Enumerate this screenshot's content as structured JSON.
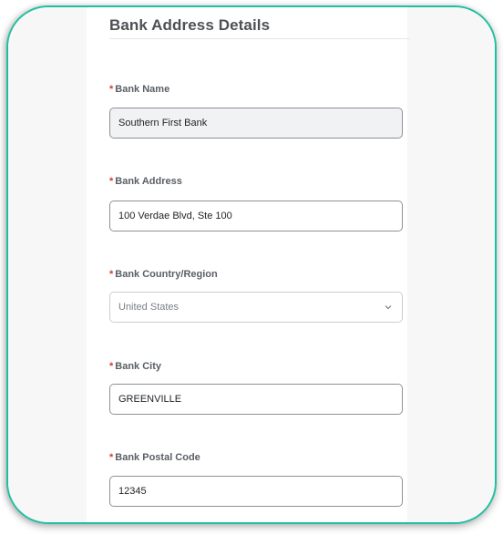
{
  "section": {
    "title": "Bank Address Details"
  },
  "required_marker": "*",
  "fields": {
    "bank_name": {
      "label": "Bank Name",
      "value": "Southern First Bank"
    },
    "bank_address": {
      "label": "Bank Address",
      "value": "100 Verdae Blvd, Ste 100"
    },
    "bank_country": {
      "label": "Bank Country/Region",
      "value": "United States"
    },
    "bank_city": {
      "label": "Bank City",
      "value": "GREENVILLE"
    },
    "bank_postal_code": {
      "label": "Bank Postal Code",
      "value": "12345"
    }
  },
  "icons": {
    "dropdown": "chevron-down-icon"
  },
  "colors": {
    "card_border": "#1fbfa3",
    "required": "#d43a2f"
  }
}
